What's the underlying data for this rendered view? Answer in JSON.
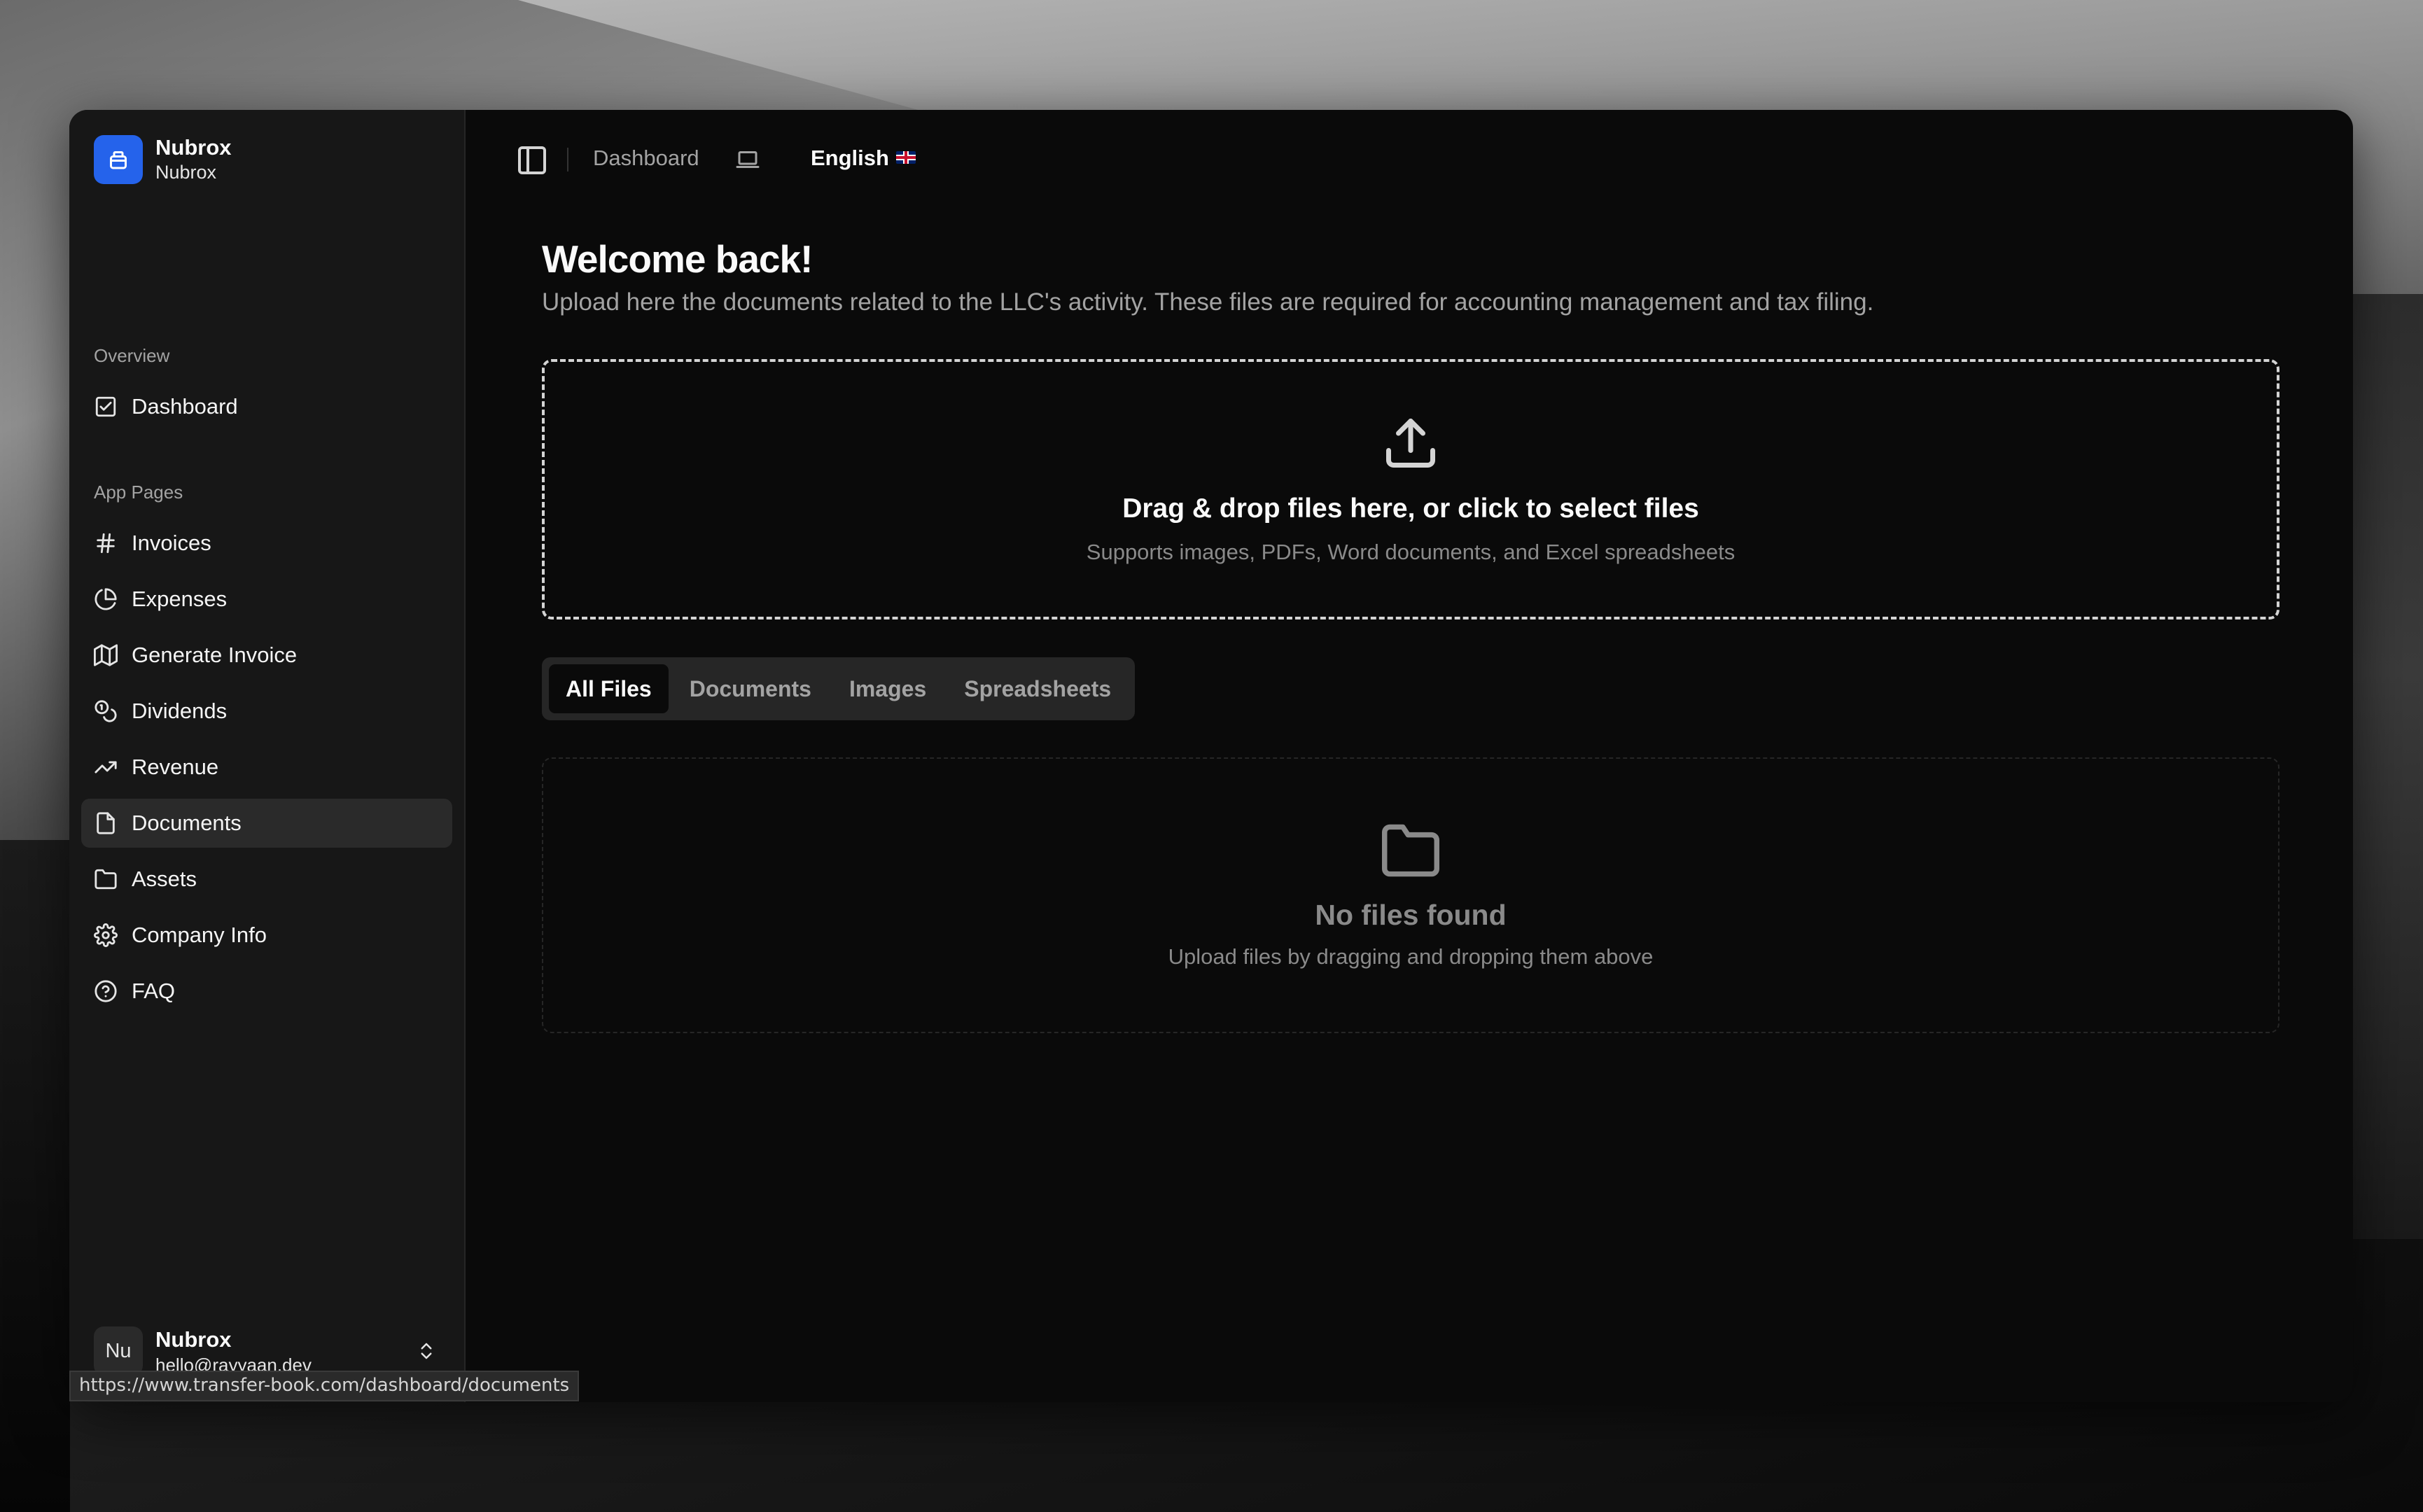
{
  "brand": {
    "name": "Nubrox",
    "subtitle": "Nubrox"
  },
  "sidebar": {
    "overview_label": "Overview",
    "overview_items": [
      {
        "label": "Dashboard",
        "icon": "dashboard-icon"
      }
    ],
    "app_pages_label": "App Pages",
    "items": [
      {
        "label": "Invoices",
        "icon": "hash-icon"
      },
      {
        "label": "Expenses",
        "icon": "pie-chart-icon"
      },
      {
        "label": "Generate Invoice",
        "icon": "map-icon"
      },
      {
        "label": "Dividends",
        "icon": "coins-icon"
      },
      {
        "label": "Revenue",
        "icon": "trending-up-icon"
      },
      {
        "label": "Documents",
        "icon": "file-icon",
        "active": true
      },
      {
        "label": "Assets",
        "icon": "folder-icon"
      },
      {
        "label": "Company Info",
        "icon": "gear-icon"
      },
      {
        "label": "FAQ",
        "icon": "help-circle-icon"
      }
    ],
    "user": {
      "initials": "Nu",
      "name": "Nubrox",
      "email": "hello@rayyaan.dev"
    }
  },
  "topbar": {
    "breadcrumb": "Dashboard",
    "language": "English"
  },
  "main": {
    "title": "Welcome back!",
    "subtitle": "Upload here the documents related to the LLC's activity. These files are required for accounting management and tax filing.",
    "dropzone": {
      "title": "Drag & drop files here, or click to select files",
      "subtitle": "Supports images, PDFs, Word documents, and Excel spreadsheets"
    },
    "tabs": [
      {
        "label": "All Files",
        "active": true
      },
      {
        "label": "Documents"
      },
      {
        "label": "Images"
      },
      {
        "label": "Spreadsheets"
      }
    ],
    "empty": {
      "title": "No files found",
      "subtitle": "Upload files by dragging and dropping them above"
    }
  },
  "status_bar": {
    "url": "https://www.transfer-book.com/dashboard/documents"
  },
  "colors": {
    "brand_accent": "#2563eb",
    "background": "#0a0a0a",
    "sidebar": "#171717"
  }
}
